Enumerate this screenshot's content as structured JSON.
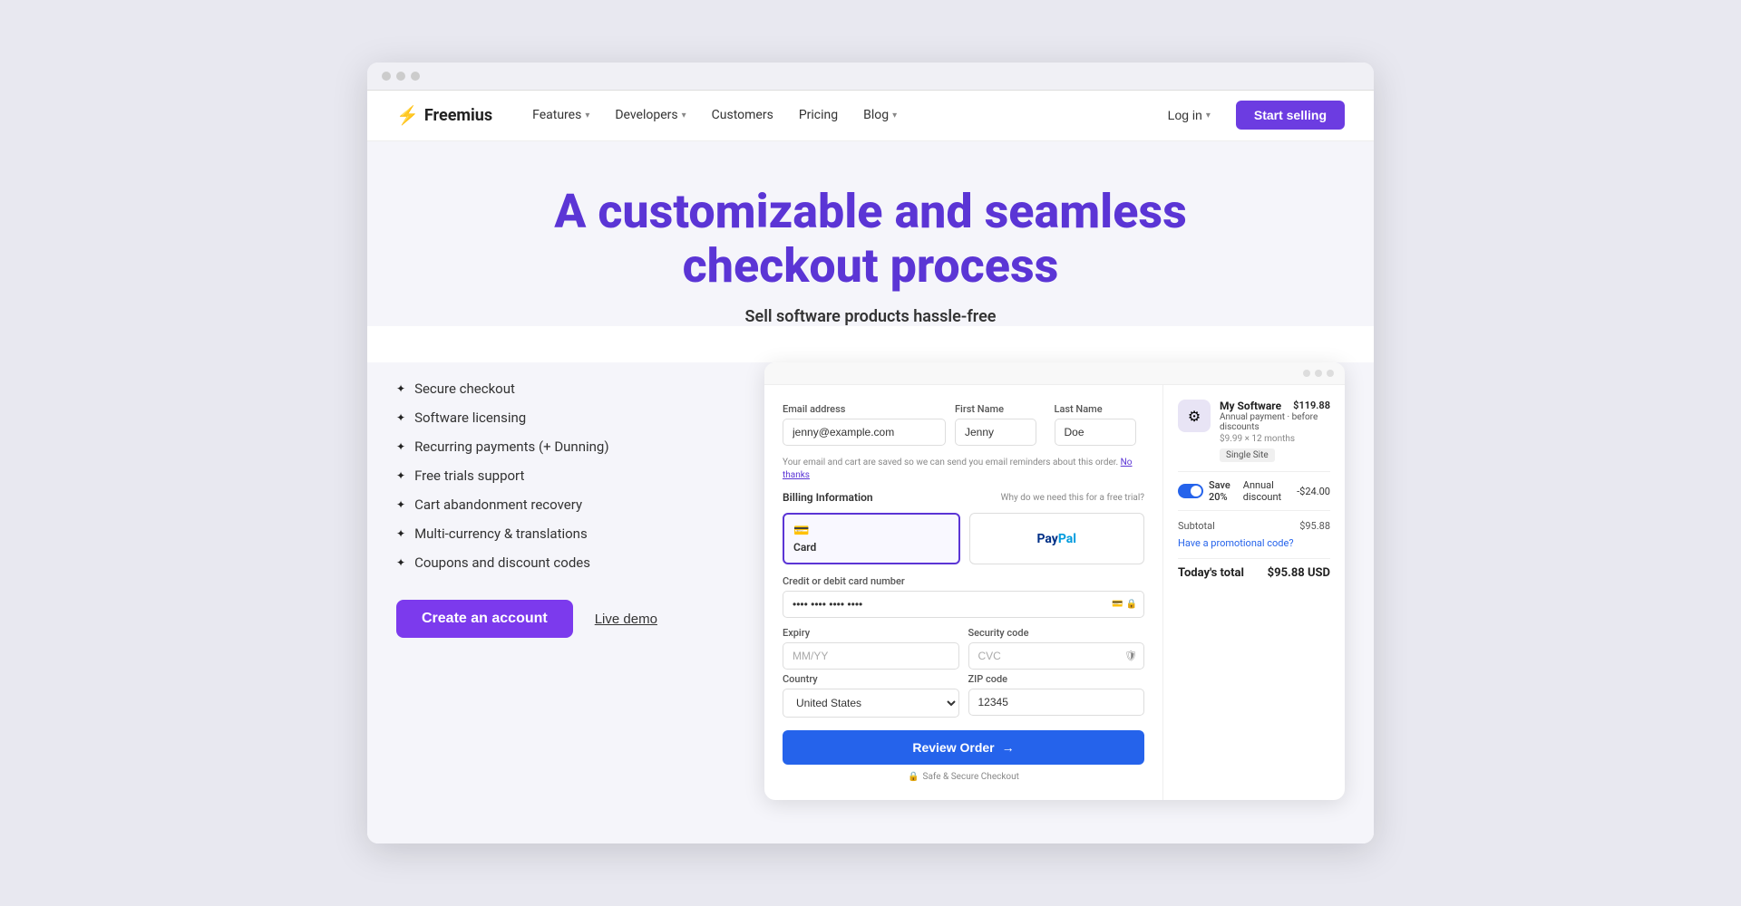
{
  "browser": {
    "dots": [
      "dot1",
      "dot2",
      "dot3"
    ]
  },
  "nav": {
    "logo_text": "Freemius",
    "logo_icon": "⚡",
    "links": [
      {
        "label": "Features",
        "has_dropdown": true
      },
      {
        "label": "Developers",
        "has_dropdown": true
      },
      {
        "label": "Customers",
        "has_dropdown": false
      },
      {
        "label": "Pricing",
        "has_dropdown": false
      },
      {
        "label": "Blog",
        "has_dropdown": true
      }
    ],
    "login_label": "Log in",
    "start_label": "Start selling"
  },
  "hero": {
    "title": "A customizable and seamless checkout process",
    "subtitle": "Sell software products hassle-free"
  },
  "features": {
    "items": [
      "Secure checkout",
      "Software licensing",
      "Recurring payments (+ Dunning)",
      "Free trials support",
      "Cart abandonment recovery",
      "Multi-currency & translations",
      "Coupons and discount codes"
    ],
    "cta_label": "Create an account",
    "demo_label": "Live demo"
  },
  "checkout": {
    "email_label": "Email address",
    "email_placeholder": "jenny@example.com",
    "first_name_label": "First Name",
    "first_name_placeholder": "Jenny",
    "last_name_label": "Last Name",
    "last_name_placeholder": "Doe",
    "email_hint": "Your email and cart are saved so we can send you email reminders about this order.",
    "no_thanks_label": "No thanks",
    "billing_label": "Billing Information",
    "why_label": "Why do we need this for a free trial?",
    "card_label": "Card",
    "paypal_label": "PayPal",
    "card_number_label": "Credit or debit card number",
    "card_number_placeholder": "•••• •••• •••• ••••",
    "expiry_label": "Expiry",
    "expiry_placeholder": "MM/YY",
    "security_label": "Security code",
    "security_placeholder": "CVC",
    "country_label": "Country",
    "country_value": "United States",
    "zip_label": "ZIP code",
    "zip_placeholder": "12345",
    "review_btn": "Review Order",
    "secure_text": "Safe & Secure Checkout"
  },
  "order": {
    "product_icon": "⚙",
    "product_name": "My Software",
    "product_desc": "Annual payment · before discounts",
    "product_price": "$119.88",
    "product_meta": "$9.99 × 12 months",
    "site_tag": "Single Site",
    "discount_label": "Save 20%",
    "discount_type": "Annual discount",
    "discount_amount": "-$24.00",
    "subtotal_label": "Subtotal",
    "subtotal_value": "$95.88",
    "promo_label": "Have a promotional code?",
    "total_label": "Today's total",
    "total_value": "$95.88 USD"
  }
}
